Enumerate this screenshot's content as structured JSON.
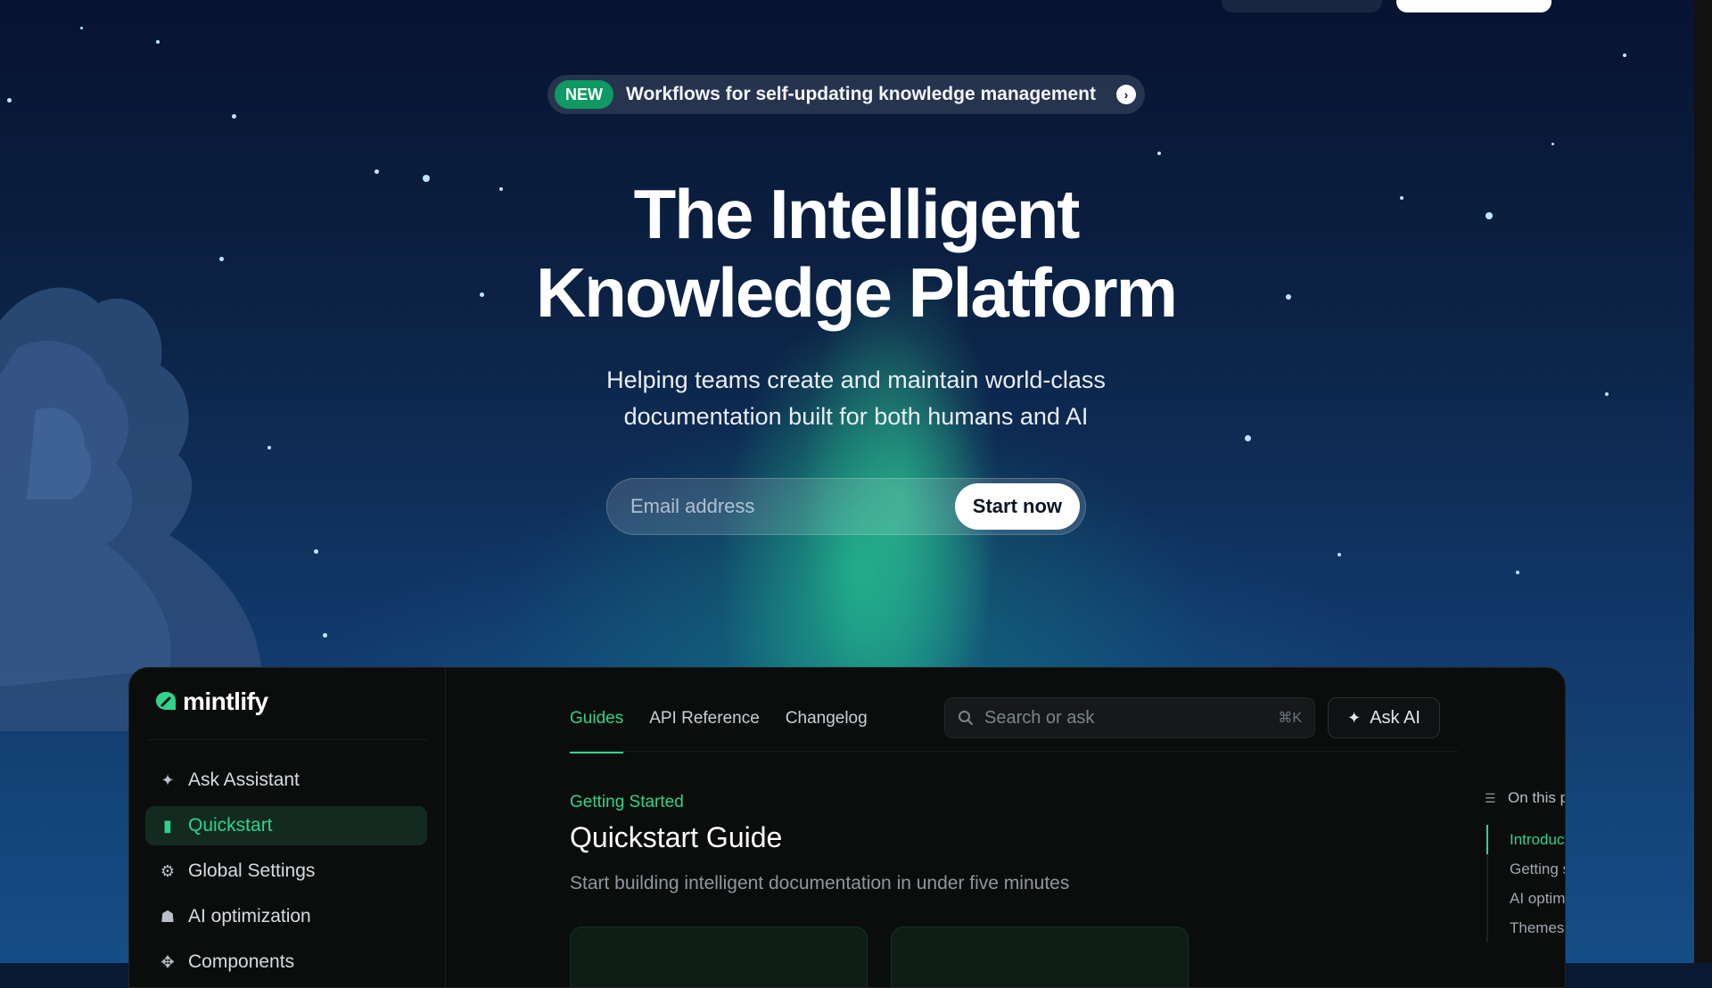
{
  "announcement": {
    "badge": "NEW",
    "text": "Workflows for self-updating knowledge management",
    "arrow_icon": "chevron-right-circle-icon"
  },
  "hero": {
    "title_line1": "The Intelligent",
    "title_line2": "Knowledge Platform",
    "subtitle_line1": "Helping teams create and maintain world-class",
    "subtitle_line2": "documentation built for both humans and AI",
    "email_placeholder": "Email address",
    "cta_label": "Start now"
  },
  "app": {
    "logo_text": "mintlify",
    "sidebar": {
      "items": [
        {
          "label": "Ask Assistant",
          "icon": "sparkle-icon",
          "active": false
        },
        {
          "label": "Quickstart",
          "icon": "book-icon",
          "active": true
        },
        {
          "label": "Global Settings",
          "icon": "gear-icon",
          "active": false
        },
        {
          "label": "AI optimization",
          "icon": "robot-icon",
          "active": false
        },
        {
          "label": "Components",
          "icon": "shapes-icon",
          "active": false
        }
      ]
    },
    "tabs": [
      {
        "label": "Guides",
        "active": true
      },
      {
        "label": "API Reference",
        "active": false
      },
      {
        "label": "Changelog",
        "active": false
      }
    ],
    "search": {
      "placeholder": "Search or ask",
      "shortcut": "⌘K"
    },
    "ask_ai_label": "Ask AI",
    "breadcrumb": "Getting Started",
    "page_title": "Quickstart Guide",
    "page_subtitle": "Start building intelligent documentation in under five minutes",
    "toc": {
      "heading": "On this page",
      "items": [
        {
          "label": "Introduction",
          "active": true
        },
        {
          "label": "Getting started",
          "active": false
        },
        {
          "label": "AI optimization",
          "active": false
        },
        {
          "label": "Themes",
          "active": false
        }
      ]
    }
  },
  "colors": {
    "accent_green": "#2ed48a",
    "badge_green": "#0f9a63",
    "sky_dark": "#071330",
    "app_bg": "#0b0d0d"
  }
}
